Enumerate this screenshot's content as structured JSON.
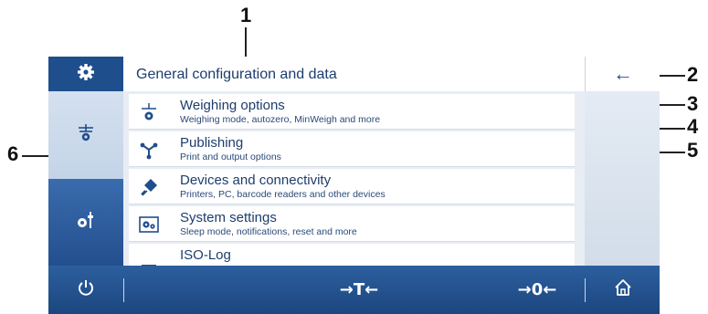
{
  "callouts": [
    "1",
    "2",
    "3",
    "4",
    "5",
    "6"
  ],
  "header": {
    "title": "General configuration and data",
    "back_icon": "arrow-left-icon"
  },
  "sidebar": [
    {
      "name": "settings",
      "icon": "gear-icon"
    },
    {
      "name": "weighing",
      "icon": "balance-icon"
    },
    {
      "name": "configuration",
      "icon": "sliders-gear-icon"
    }
  ],
  "list": [
    {
      "title": "Weighing options",
      "subtitle": "Weighing mode, autozero, MinWeigh and more",
      "icon": "weighing-options-icon"
    },
    {
      "title": "Publishing",
      "subtitle": "Print and output options",
      "icon": "publish-icon"
    },
    {
      "title": "Devices and connectivity",
      "subtitle": "Printers, PC, barcode readers and other devices",
      "icon": "plug-icon"
    },
    {
      "title": "System settings",
      "subtitle": "Sleep mode, notifications, reset and more",
      "icon": "system-settings-icon"
    },
    {
      "title": "ISO-Log",
      "subtitle": "",
      "icon": "log-icon"
    }
  ],
  "bottom_bar": {
    "power_icon": "power-icon",
    "tare_label": "→T←",
    "zero_label": "→0←",
    "home_icon": "home-icon"
  },
  "colors": {
    "primary": "#1f4e8c",
    "text": "#1d3d6e",
    "background": "#eef1f6"
  }
}
